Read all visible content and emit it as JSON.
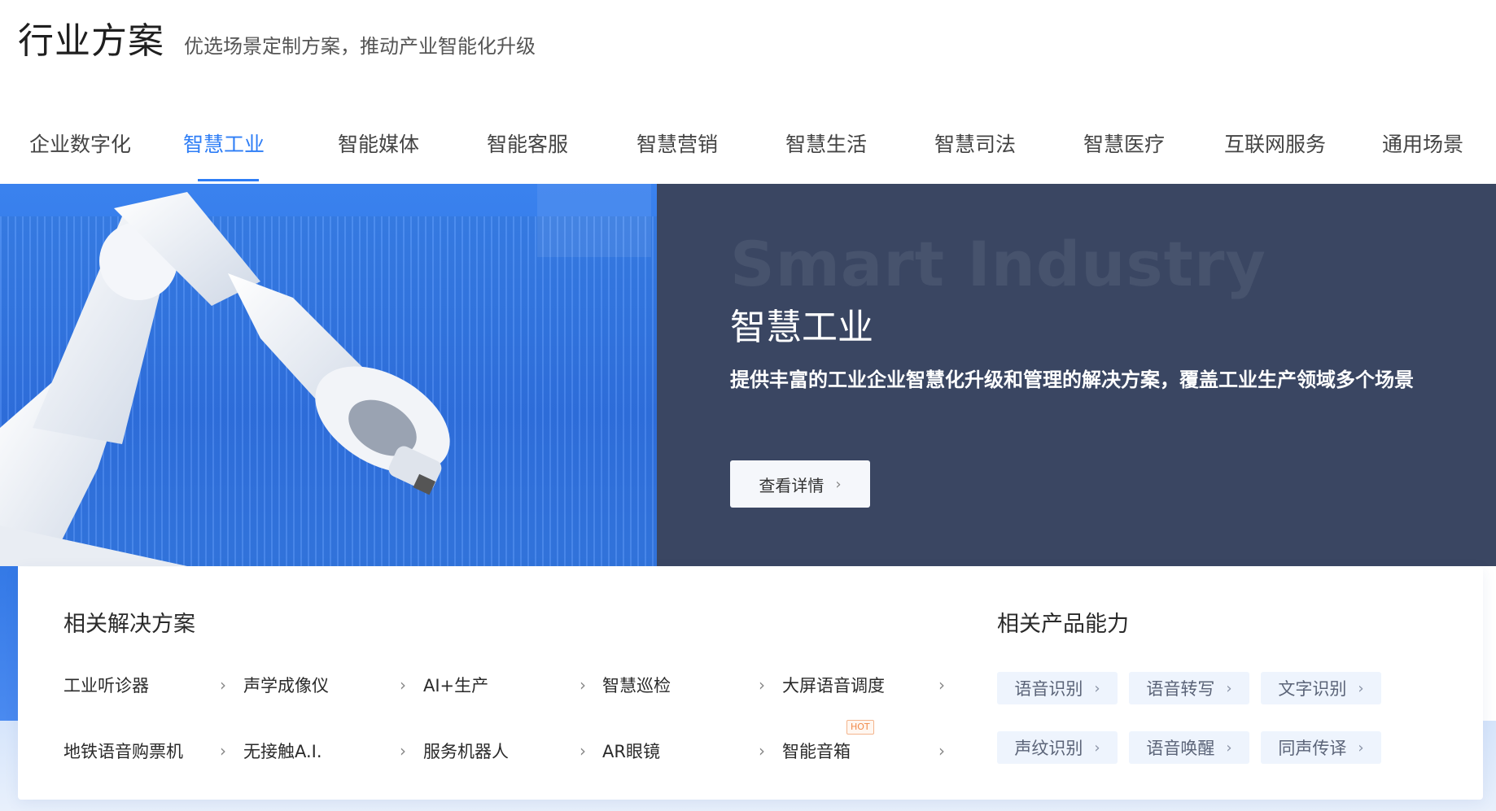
{
  "header": {
    "title": "行业方案",
    "subtitle": "优选场景定制方案，推动产业智能化升级"
  },
  "tabs": [
    {
      "label": "企业数字化",
      "active": false
    },
    {
      "label": "智慧工业",
      "active": true
    },
    {
      "label": "智能媒体",
      "active": false
    },
    {
      "label": "智能客服",
      "active": false
    },
    {
      "label": "智慧营销",
      "active": false
    },
    {
      "label": "智慧生活",
      "active": false
    },
    {
      "label": "智慧司法",
      "active": false
    },
    {
      "label": "智慧医疗",
      "active": false
    },
    {
      "label": "互联网服务",
      "active": false
    },
    {
      "label": "通用场景",
      "active": false
    }
  ],
  "hero": {
    "en_title": "Smart Industry",
    "cn_title": "智慧工业",
    "description": "提供丰富的工业企业智慧化升级和管理的解决方案，覆盖工业生产领域多个场景",
    "button_label": "查看详情",
    "chevron": "›"
  },
  "solutions": {
    "title": "相关解决方案",
    "items": [
      {
        "label": "工业听诊器"
      },
      {
        "label": "声学成像仪"
      },
      {
        "label": "AI+生产"
      },
      {
        "label": "智慧巡检"
      },
      {
        "label": "大屏语音调度"
      },
      {
        "label": "地铁语音购票机"
      },
      {
        "label": "无接触A.I."
      },
      {
        "label": "服务机器人"
      },
      {
        "label": "AR眼镜"
      },
      {
        "label": "智能音箱",
        "badge": "HOT"
      }
    ]
  },
  "products": {
    "title": "相关产品能力",
    "items": [
      {
        "label": "语音识别"
      },
      {
        "label": "语音转写"
      },
      {
        "label": "文字识别"
      },
      {
        "label": "声纹识别"
      },
      {
        "label": "语音唤醒"
      },
      {
        "label": "同声传译"
      }
    ]
  },
  "colors": {
    "accent": "#2d7df6",
    "hero_bg": "#3a4662",
    "hot": "#f08a4b"
  }
}
